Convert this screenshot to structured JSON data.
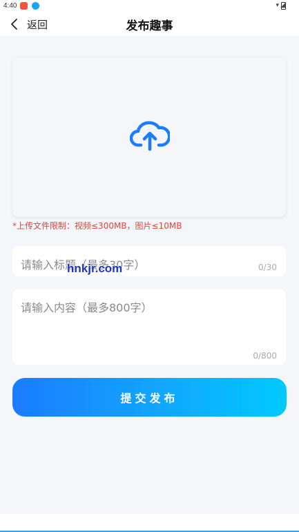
{
  "status_bar": {
    "time": "4:40"
  },
  "header": {
    "back_label": "返回",
    "title": "发布趣事"
  },
  "upload": {
    "note": "*上传文件限制：视频≤300MB，图片≤10MB",
    "icon": "cloud-upload-icon"
  },
  "title_field": {
    "placeholder": "请输入标题（最多30字）",
    "counter": "0/30"
  },
  "content_field": {
    "placeholder": "请输入内容（最多800字）",
    "counter": "0/800"
  },
  "watermark": "hnkjr.com",
  "submit": {
    "label": "提交发布"
  },
  "colors": {
    "accent": "#1a7cff",
    "accent_end": "#00c9ff",
    "warning": "#e0443a"
  }
}
